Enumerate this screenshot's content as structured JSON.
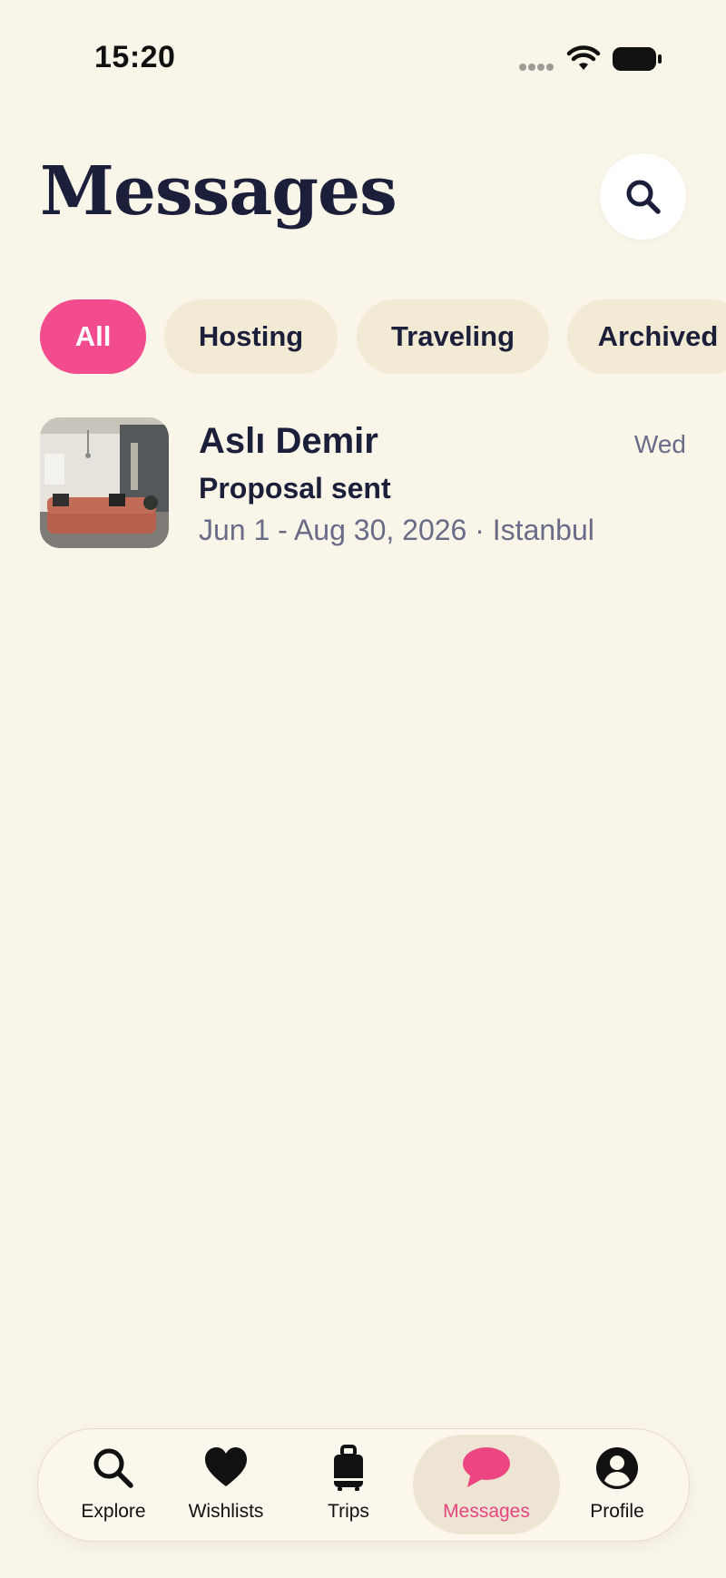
{
  "status_bar": {
    "time": "15:20"
  },
  "header": {
    "title": "Messages"
  },
  "filters": [
    {
      "label": "All",
      "active": true
    },
    {
      "label": "Hosting",
      "active": false
    },
    {
      "label": "Traveling",
      "active": false
    },
    {
      "label": "Archived",
      "active": false
    }
  ],
  "threads": [
    {
      "name": "Aslı Demir",
      "date": "Wed",
      "status": "Proposal sent",
      "details": "Jun 1 - Aug 30, 2026 · Istanbul"
    }
  ],
  "tab_bar": {
    "items": [
      {
        "label": "Explore",
        "icon": "search-icon"
      },
      {
        "label": "Wishlists",
        "icon": "heart-icon"
      },
      {
        "label": "Trips",
        "icon": "suitcase-icon"
      },
      {
        "label": "Messages",
        "icon": "chat-bubble-icon",
        "active": true
      },
      {
        "label": "Profile",
        "icon": "profile-icon"
      }
    ]
  },
  "colors": {
    "background": "#f9f5e8",
    "accent": "#f24b8e",
    "text_primary": "#1c1f3a",
    "text_secondary": "#6a6b88"
  }
}
